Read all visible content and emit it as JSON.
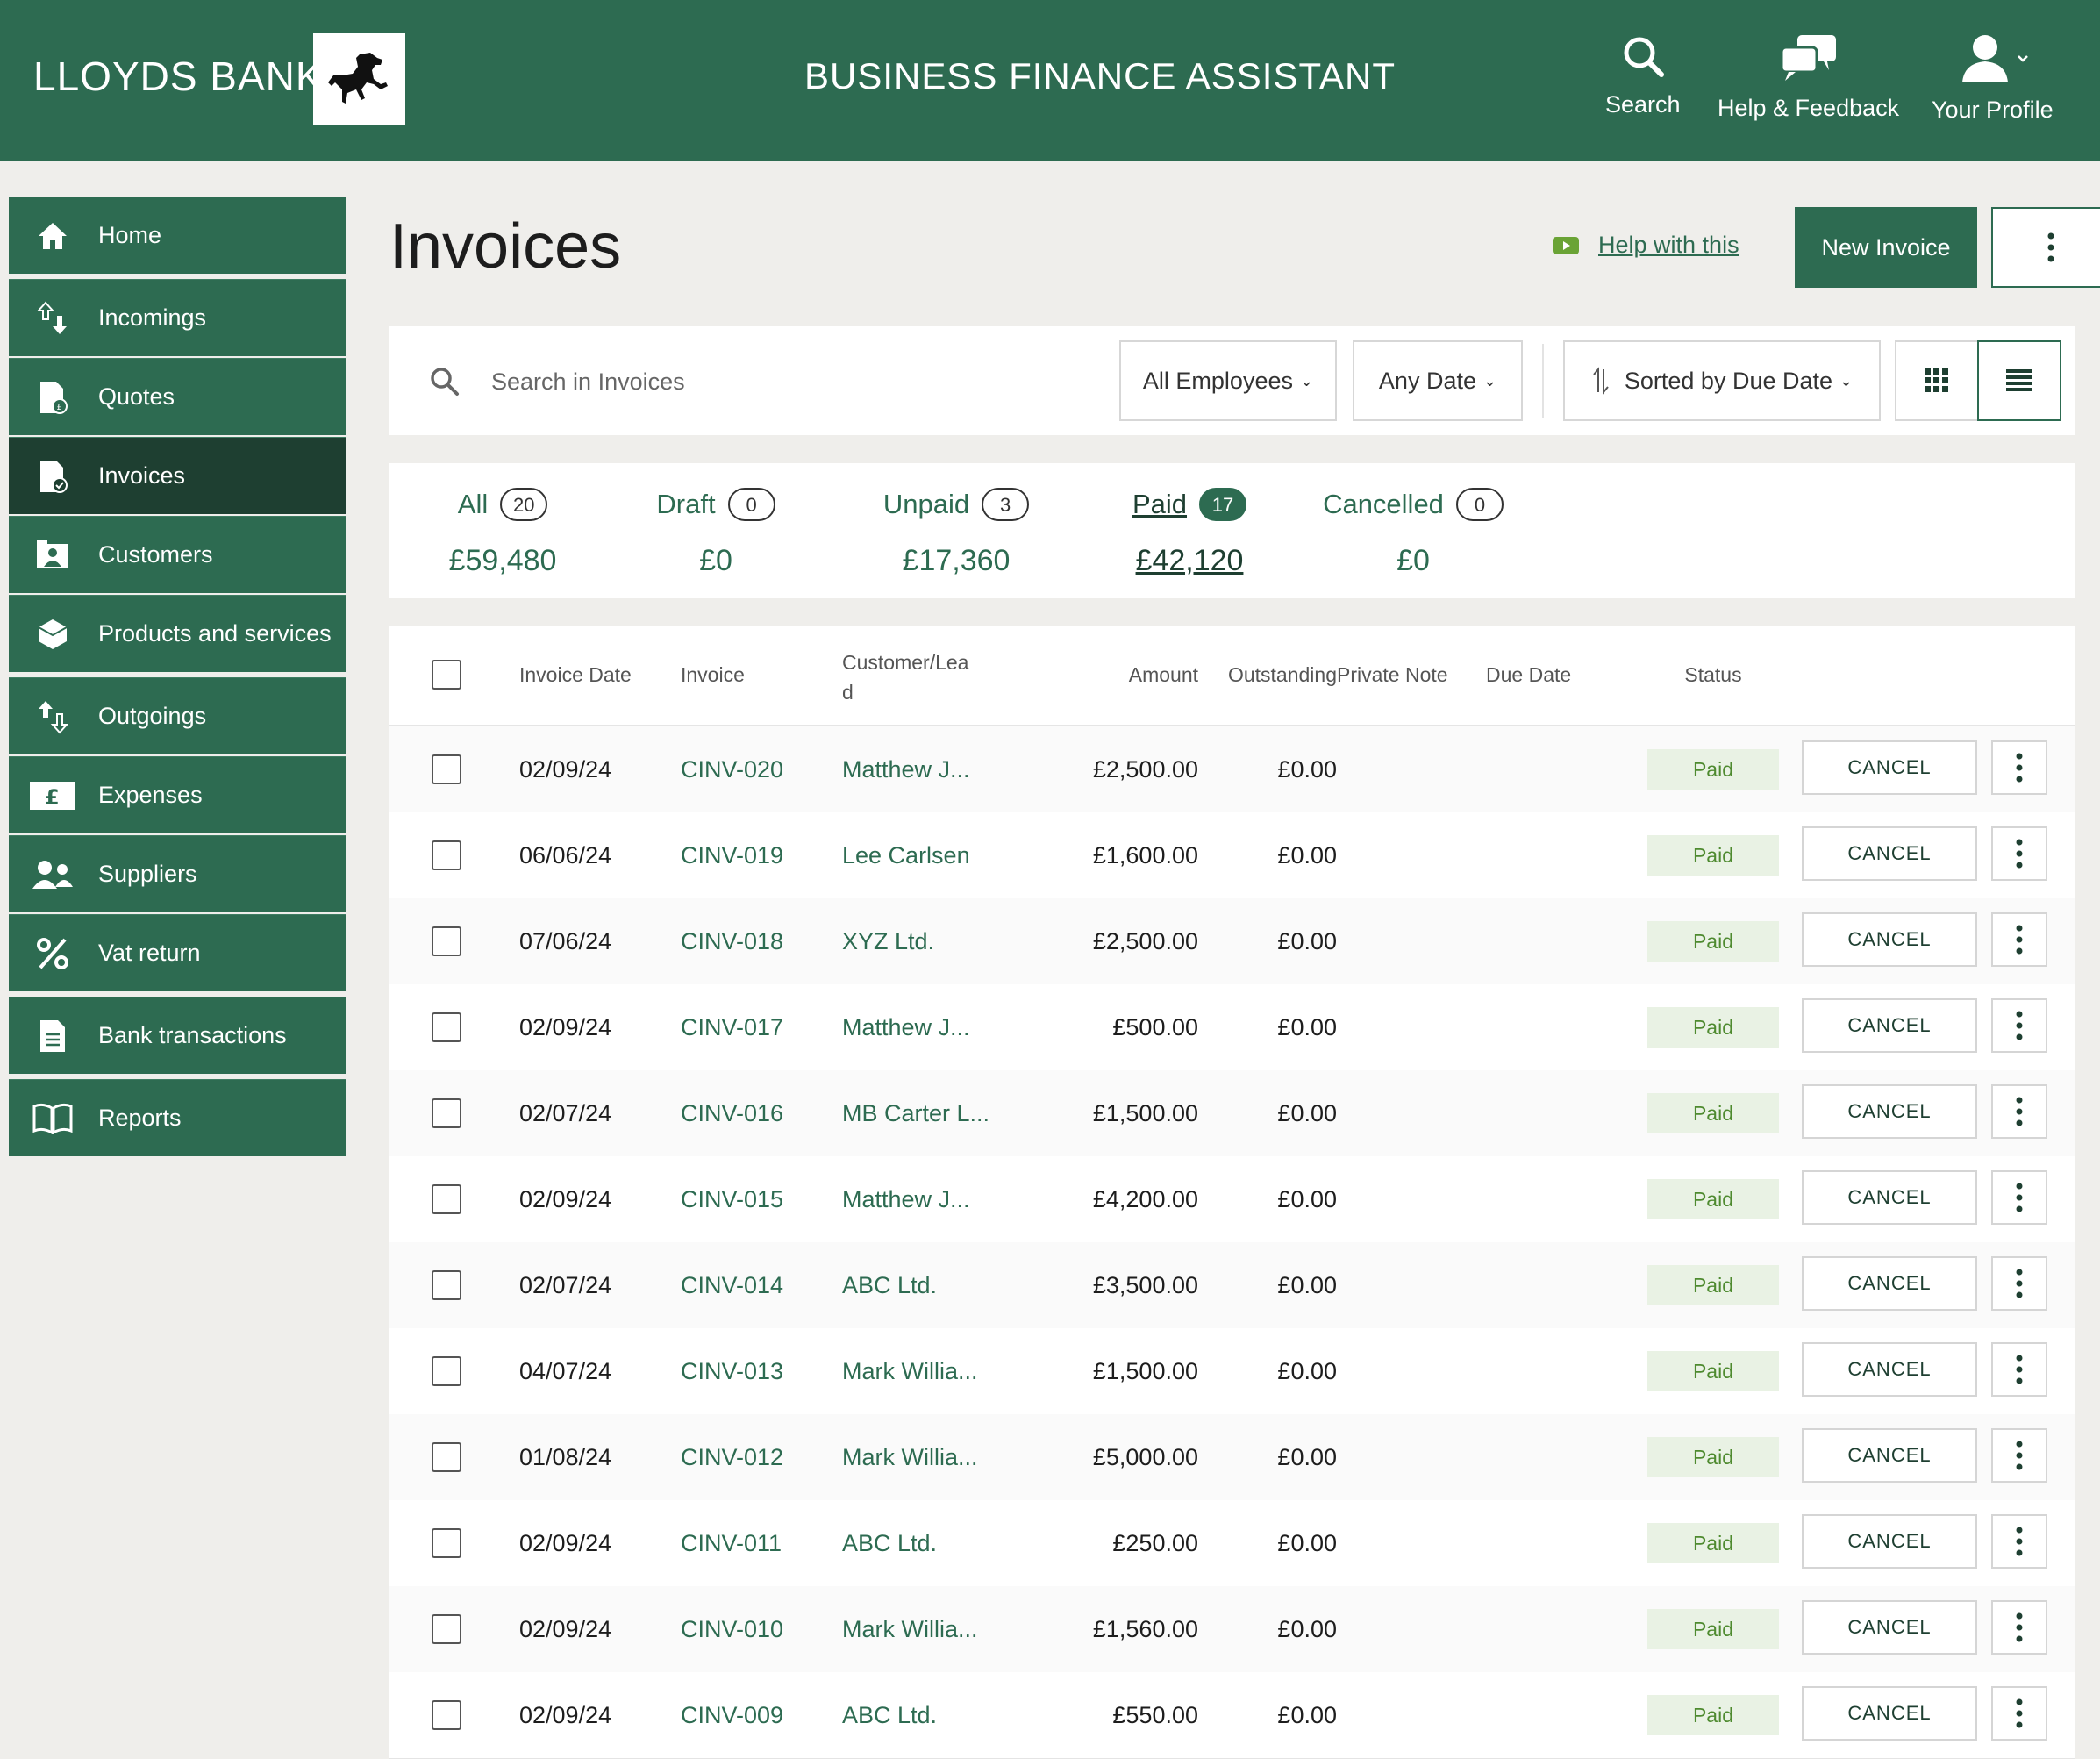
{
  "header": {
    "brand": "LLOYDS BANK",
    "app_title": "BUSINESS FINANCE ASSISTANT",
    "actions": {
      "search": "Search",
      "help": "Help & Feedback",
      "profile": "Your Profile"
    }
  },
  "sidebar": {
    "items": [
      {
        "label": "Home",
        "icon": "home-icon"
      },
      {
        "label": "Incomings",
        "icon": "incomings-icon"
      },
      {
        "label": "Quotes",
        "icon": "quote-document-icon"
      },
      {
        "label": "Invoices",
        "icon": "invoice-document-icon",
        "active": true
      },
      {
        "label": "Customers",
        "icon": "customers-icon"
      },
      {
        "label": "Products and services",
        "icon": "box-icon"
      },
      {
        "label": "Outgoings",
        "icon": "outgoings-icon"
      },
      {
        "label": "Expenses",
        "icon": "pound-icon"
      },
      {
        "label": "Suppliers",
        "icon": "suppliers-icon"
      },
      {
        "label": "Vat return",
        "icon": "percent-icon"
      },
      {
        "label": "Bank transactions",
        "icon": "bank-document-icon"
      },
      {
        "label": "Reports",
        "icon": "book-icon"
      }
    ]
  },
  "main": {
    "title": "Invoices",
    "help_link": "Help with this",
    "new_invoice": "New Invoice"
  },
  "filters": {
    "search_placeholder": "Search in Invoices",
    "employees": "All Employees",
    "date": "Any Date",
    "sort": "Sorted by Due Date"
  },
  "summary": [
    {
      "name": "All",
      "count": "20",
      "amount": "£59,480"
    },
    {
      "name": "Draft",
      "count": "0",
      "amount": "£0"
    },
    {
      "name": "Unpaid",
      "count": "3",
      "amount": "£17,360"
    },
    {
      "name": "Paid",
      "count": "17",
      "amount": "£42,120",
      "selected": true
    },
    {
      "name": "Cancelled",
      "count": "0",
      "amount": "£0"
    }
  ],
  "table": {
    "columns": {
      "invoice_date": "Invoice Date",
      "invoice": "Invoice",
      "customer_line1": "Customer/Lea",
      "customer_line2": "d",
      "amount": "Amount",
      "outstanding": "Outstanding",
      "private_note": "Private Note",
      "due_date": "Due Date",
      "status": "Status"
    },
    "cancel_label": "CANCEL",
    "rows": [
      {
        "date": "02/09/24",
        "invoice": "CINV-020",
        "customer": "Matthew J...",
        "amount": "£2,500.00",
        "outstanding": "£0.00",
        "status": "Paid"
      },
      {
        "date": "06/06/24",
        "invoice": "CINV-019",
        "customer": "Lee Carlsen",
        "amount": "£1,600.00",
        "outstanding": "£0.00",
        "status": "Paid"
      },
      {
        "date": "07/06/24",
        "invoice": "CINV-018",
        "customer": "XYZ Ltd.",
        "amount": "£2,500.00",
        "outstanding": "£0.00",
        "status": "Paid"
      },
      {
        "date": "02/09/24",
        "invoice": "CINV-017",
        "customer": "Matthew J...",
        "amount": "£500.00",
        "outstanding": "£0.00",
        "status": "Paid"
      },
      {
        "date": "02/07/24",
        "invoice": "CINV-016",
        "customer": "MB Carter L...",
        "amount": "£1,500.00",
        "outstanding": "£0.00",
        "status": "Paid"
      },
      {
        "date": "02/09/24",
        "invoice": "CINV-015",
        "customer": "Matthew J...",
        "amount": "£4,200.00",
        "outstanding": "£0.00",
        "status": "Paid"
      },
      {
        "date": "02/07/24",
        "invoice": "CINV-014",
        "customer": "ABC Ltd.",
        "amount": "£3,500.00",
        "outstanding": "£0.00",
        "status": "Paid"
      },
      {
        "date": "04/07/24",
        "invoice": "CINV-013",
        "customer": "Mark Willia...",
        "amount": "£1,500.00",
        "outstanding": "£0.00",
        "status": "Paid"
      },
      {
        "date": "01/08/24",
        "invoice": "CINV-012",
        "customer": "Mark Willia...",
        "amount": "£5,000.00",
        "outstanding": "£0.00",
        "status": "Paid"
      },
      {
        "date": "02/09/24",
        "invoice": "CINV-011",
        "customer": "ABC Ltd.",
        "amount": "£250.00",
        "outstanding": "£0.00",
        "status": "Paid"
      },
      {
        "date": "02/09/24",
        "invoice": "CINV-010",
        "customer": "Mark Willia...",
        "amount": "£1,560.00",
        "outstanding": "£0.00",
        "status": "Paid"
      },
      {
        "date": "02/09/24",
        "invoice": "CINV-009",
        "customer": "ABC Ltd.",
        "amount": "£550.00",
        "outstanding": "£0.00",
        "status": "Paid"
      }
    ]
  },
  "colors": {
    "brand_green": "#2d6b51",
    "active_nav": "#1e3f31",
    "paid_badge_bg": "#e9f2e4",
    "paid_badge_text": "#4e8a2f"
  }
}
